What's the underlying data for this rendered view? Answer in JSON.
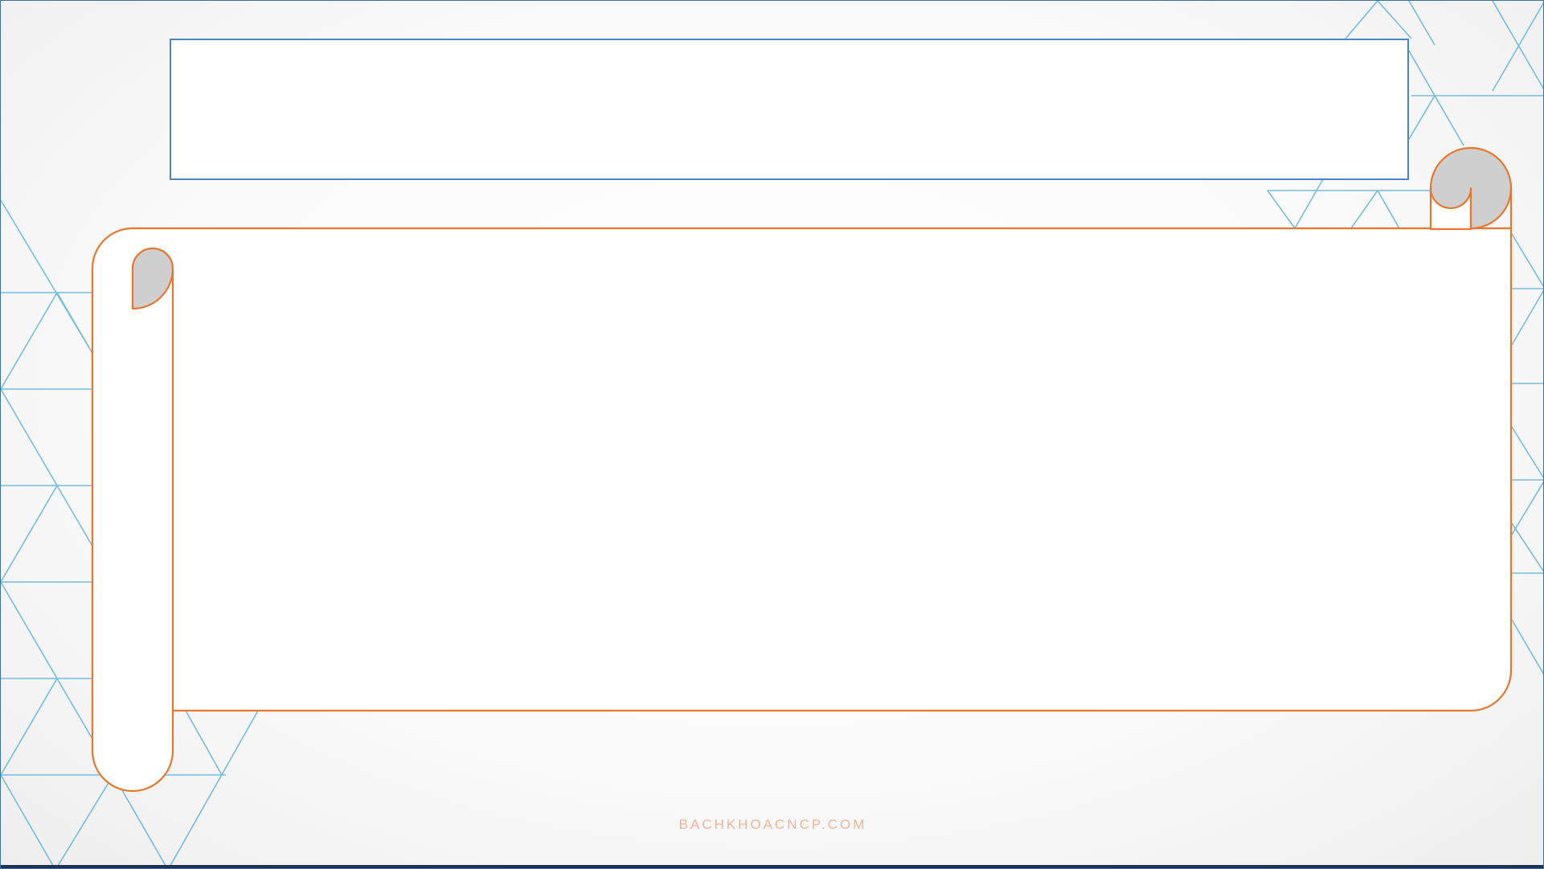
{
  "slide": {
    "title_text": "",
    "body_text": "",
    "watermark": "BACHKHOACNCP.COM"
  },
  "colors": {
    "scroll_outline": "#e8772e",
    "scroll_curl": "#cfcfcf",
    "title_border": "#4a86c5",
    "pattern_lines": "#5fb3d9",
    "watermark": "#f0b49a"
  },
  "icons": {
    "background_pattern": "triangle-grid-pattern",
    "scroll_frame": "paper-scroll-icon"
  }
}
